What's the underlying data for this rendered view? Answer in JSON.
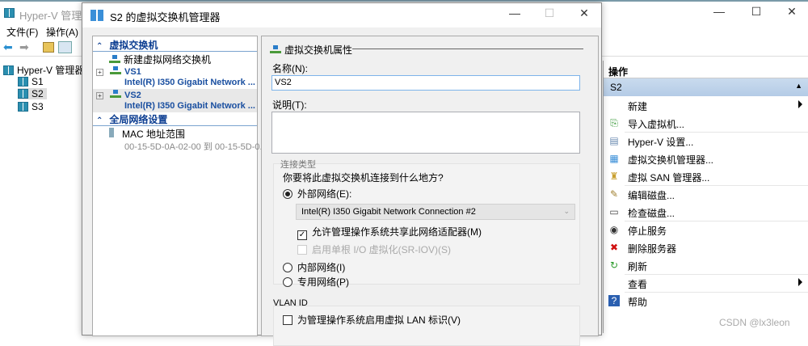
{
  "main_window": {
    "title": "Hyper-V 管理器",
    "menu": [
      "文件(F)",
      "操作(A)"
    ],
    "tree": {
      "root": "Hyper-V 管理器",
      "servers": [
        "S1",
        "S2",
        "S3"
      ],
      "selected": "S2"
    }
  },
  "actions": {
    "header": "操作",
    "section": "S2",
    "items": [
      {
        "label": "新建",
        "icon": "new",
        "submenu": true
      },
      {
        "label": "导入虚拟机...",
        "icon": "import-icon"
      },
      {
        "label": "Hyper-V 设置...",
        "icon": "settings-icon"
      },
      {
        "label": "虚拟交换机管理器...",
        "icon": "switch-icon"
      },
      {
        "label": "虚拟 SAN 管理器...",
        "icon": "san-icon"
      },
      {
        "label": "编辑磁盘...",
        "icon": "edit-disk-icon"
      },
      {
        "label": "检查磁盘...",
        "icon": "inspect-disk-icon"
      },
      {
        "label": "停止服务",
        "icon": "stop-icon"
      },
      {
        "label": "删除服务器",
        "icon": "delete-icon"
      },
      {
        "label": "刷新",
        "icon": "refresh-icon"
      },
      {
        "label": "查看",
        "icon": "view",
        "submenu": true
      },
      {
        "label": "帮助",
        "icon": "help-icon"
      }
    ]
  },
  "dialog": {
    "title": "S2 的虚拟交换机管理器",
    "left": {
      "section1": "虚拟交换机",
      "new_switch": "新建虚拟网络交换机",
      "switches": [
        {
          "name": "VS1",
          "adapter": "Intel(R) I350 Gigabit Network ..."
        },
        {
          "name": "VS2",
          "adapter": "Intel(R) I350 Gigabit Network ..."
        }
      ],
      "section2": "全局网络设置",
      "mac_label": "MAC 地址范围",
      "mac_value": "00-15-5D-0A-02-00 到 00-15-5D-0..."
    },
    "right": {
      "group_title": "虚拟交换机属性",
      "name_label": "名称(N):",
      "name_value": "VS2",
      "desc_label": "说明(T):",
      "desc_value": "",
      "conn_type": "连接类型",
      "conn_question": "你要将此虚拟交换机连接到什么地方?",
      "external": "外部网络(E):",
      "adapter_selected": "Intel(R) I350 Gigabit Network Connection #2",
      "allow_mgmt": "允许管理操作系统共享此网络适配器(M)",
      "allow_mgmt_checked": true,
      "sriov": "启用单根 I/O 虚拟化(SR-IOV)(S)",
      "sriov_checked": false,
      "internal": "内部网络(I)",
      "private": "专用网络(P)",
      "selected_type": "external",
      "vlan_title": "VLAN ID",
      "vlan_check": "为管理操作系统启用虚拟 LAN 标识(V)",
      "vlan_checked": false
    }
  },
  "watermark": "CSDN @lx3leon"
}
